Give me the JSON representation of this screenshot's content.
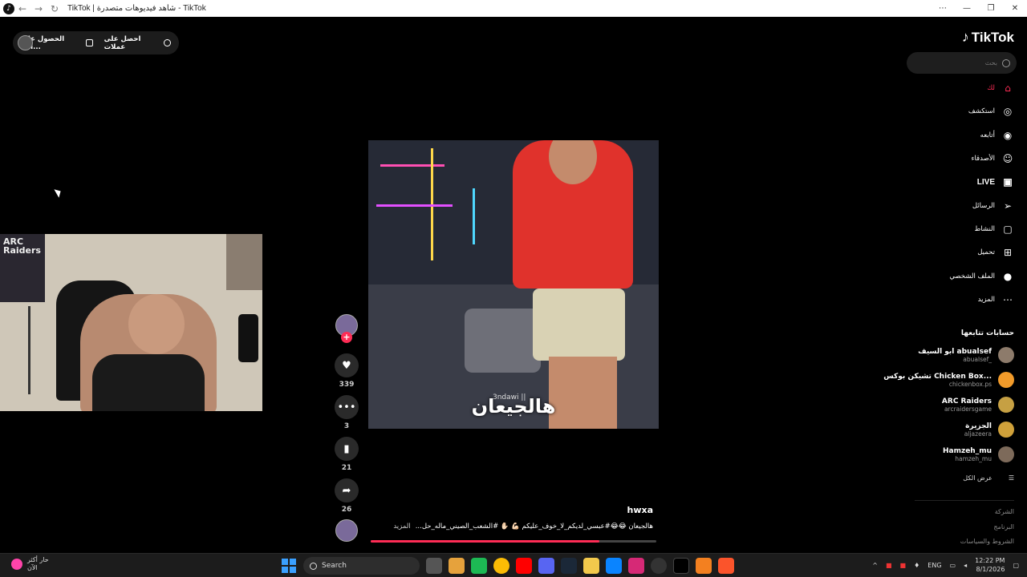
{
  "browser": {
    "tab_title": "TikTok | شاهد فيديوهات متصدرة - TikTok",
    "back": "←",
    "forward": "→",
    "reload": "↻",
    "more": "⋯",
    "minimize": "—",
    "restore": "❐",
    "close": "✕"
  },
  "top_pill": {
    "coins": "احصل على عملات",
    "app": "الحصول على الت..."
  },
  "video": {
    "caption": "هالجيعان",
    "handle": "3ndawi ||",
    "username": "hwxa",
    "description": "هالجيعان 😂😂#عبسي_لديكم_لا_خوف_عليكم 💪🏻 ✋🏻 #الشعب_الصيني_ماله_حل...",
    "more": "المزيد",
    "progress": 0.8
  },
  "actions": {
    "follow_plus": "+",
    "likes": "339",
    "comments": "3",
    "saves": "21",
    "shares": "26"
  },
  "sidebar": {
    "logo": "TikTok",
    "search_placeholder": "بحث",
    "nav": [
      {
        "label": "لك",
        "icon": "home-icon"
      },
      {
        "label": "استكشف",
        "icon": "compass-icon"
      },
      {
        "label": "أتابعه",
        "icon": "following-icon"
      },
      {
        "label": "الأصدقاء",
        "icon": "friends-icon"
      },
      {
        "label": "LIVE",
        "icon": "live-icon"
      },
      {
        "label": "الرسائل",
        "icon": "send-icon"
      },
      {
        "label": "النشاط",
        "icon": "chat-icon"
      },
      {
        "label": "تحميل",
        "icon": "upload-icon"
      },
      {
        "label": "الملف الشخصي",
        "icon": "profile-icon"
      },
      {
        "label": "المزيد",
        "icon": "more-icon"
      }
    ],
    "following_header": "حسابات تتابعها",
    "following": [
      {
        "name": "ابو السيف abualsef",
        "user": "abualsef_"
      },
      {
        "name": "تشيكن بوكس Chicken Box...",
        "user": "chickenbox.ps"
      },
      {
        "name": "ARC Raiders",
        "user": "arcraidersgame"
      },
      {
        "name": "الجزيرة",
        "user": "aljazeera"
      },
      {
        "name": "Hamzeh_mu",
        "user": "hamzeh_mu"
      }
    ],
    "see_all": "عرض الكل",
    "footer": [
      "الشركة",
      "البرنامج",
      "الشروط والسياسات"
    ]
  },
  "taskbar": {
    "weather_line1": "حار أكثر",
    "weather_line2": "الآن",
    "search": "Search",
    "lang": "ENG",
    "time": "12:22 PM",
    "date": "8/1/2026"
  },
  "webcam": {
    "poster_text": "ARC Raiders"
  }
}
